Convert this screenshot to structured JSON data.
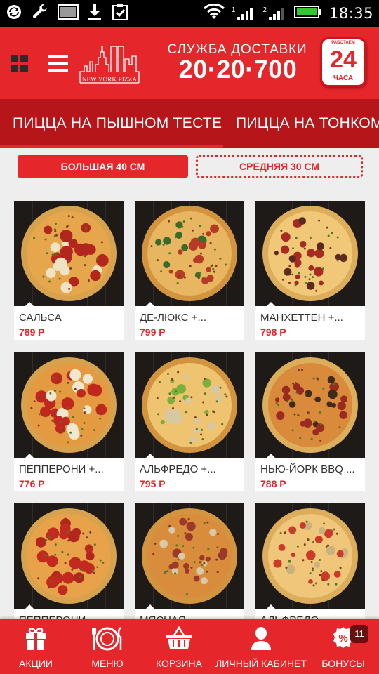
{
  "status_bar": {
    "time": "18:35",
    "signal_labels": [
      "1",
      "2"
    ]
  },
  "header": {
    "logo_text": "NEW YORK PIZZA",
    "delivery_title": "СЛУЖБА ДОСТАВКИ",
    "delivery_phone": "20·20·700",
    "badge_number": "24",
    "badge_label": "ЧАСА",
    "badge_top": "РАБОТАЕМ"
  },
  "category_tabs": [
    {
      "label": "ПИЦЦА НА ПЫШНОМ ТЕСТЕ",
      "active": true
    },
    {
      "label": "ПИЦЦА НА ТОНКОМ",
      "active": false
    }
  ],
  "sizes": [
    {
      "label": "БОЛЬШАЯ 40 СМ",
      "active": true
    },
    {
      "label": "СРЕДНЯЯ 30 СМ",
      "active": false
    }
  ],
  "products": [
    {
      "name": "САЛЬСА",
      "price": "789 Р"
    },
    {
      "name": "ДЕ-ЛЮКС +...",
      "price": "799 Р"
    },
    {
      "name": "МАНХЕТТЕН +...",
      "price": "798 Р"
    },
    {
      "name": "ПЕППЕРОНИ +...",
      "price": "776 Р"
    },
    {
      "name": "АЛЬФРЕДО +...",
      "price": "795 Р"
    },
    {
      "name": "НЬЮ-ЙОРК BBQ ...",
      "price": "788 Р"
    },
    {
      "name": "ПЕППЕРОНИ",
      "price": ""
    },
    {
      "name": "МЯСНАЯ",
      "price": ""
    },
    {
      "name": "АЛЬФРЕДО",
      "price": ""
    }
  ],
  "bottom_nav": [
    {
      "label": "АКЦИИ",
      "icon": "gift-icon"
    },
    {
      "label": "МЕНЮ",
      "icon": "plate-cutlery-icon"
    },
    {
      "label": "КОРЗИНА",
      "icon": "basket-icon"
    },
    {
      "label": "ЛИЧНЫЙ КАБИНЕТ",
      "icon": "user-icon"
    },
    {
      "label": "БОНУСЫ",
      "icon": "percent-icon"
    }
  ],
  "bonus_badge": "11",
  "colors": {
    "brand_red": "#e5262b",
    "tab_bar": "#b6151a",
    "badge_dark": "#6a0e10"
  }
}
